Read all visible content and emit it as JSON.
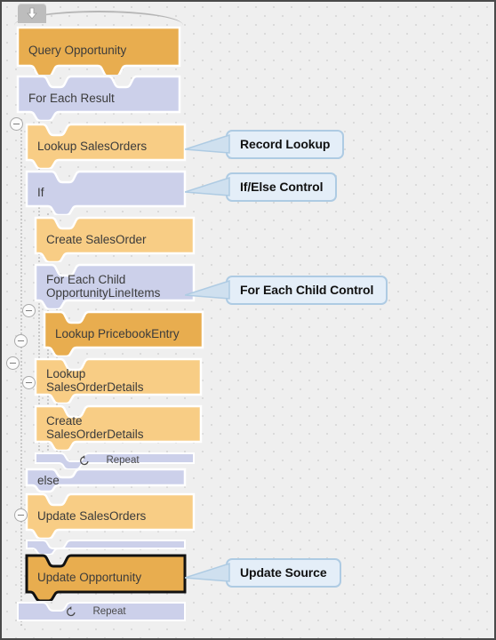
{
  "canvas": {
    "background_color": "#efefef",
    "grid": "dot-grid",
    "border_color": "#4a4a4a"
  },
  "toolbar": {
    "collapse_all_icon": "arrow-down-icon"
  },
  "palette": {
    "action_orange_dark": "#e8ad4f",
    "action_orange_light": "#f8cd85",
    "control_lavender": "#ccd0ea",
    "selected_border": "#111111",
    "callout_fill": "#e4eef8",
    "callout_border": "#aecbe3"
  },
  "blocks": [
    {
      "id": "query-opportunity",
      "label": "Query Opportunity",
      "type": "action",
      "color": "dark",
      "selected": false
    },
    {
      "id": "for-each-result",
      "label": "For Each Result",
      "type": "control",
      "color": "lavender",
      "selected": false
    },
    {
      "id": "lookup-salesorders",
      "label": "Lookup SalesOrders",
      "type": "action",
      "color": "light",
      "selected": false
    },
    {
      "id": "if",
      "label": "If",
      "type": "control",
      "color": "lavender",
      "selected": false
    },
    {
      "id": "create-salesorder",
      "label": "Create SalesOrder",
      "type": "action",
      "color": "light",
      "selected": false
    },
    {
      "id": "for-each-child",
      "label": "For Each Child\nOpportunityLineItems",
      "type": "control",
      "color": "lavender",
      "selected": false
    },
    {
      "id": "lookup-pricebookentry",
      "label": "Lookup PricebookEntry",
      "type": "action",
      "color": "dark",
      "selected": false
    },
    {
      "id": "lookup-salesorderdetails",
      "label": "Lookup\nSalesOrderDetails",
      "type": "action",
      "color": "light",
      "selected": false
    },
    {
      "id": "create-salesorderdetails",
      "label": "Create\nSalesOrderDetails",
      "type": "action",
      "color": "light",
      "selected": false
    },
    {
      "id": "repeat-inner",
      "label": "Repeat",
      "type": "repeat",
      "color": "lavender",
      "selected": false
    },
    {
      "id": "else",
      "label": "else",
      "type": "control",
      "color": "lavender",
      "selected": false
    },
    {
      "id": "update-salesorders",
      "label": "Update SalesOrders",
      "type": "action",
      "color": "light",
      "selected": false
    },
    {
      "id": "endif-bar",
      "label": "",
      "type": "thin",
      "color": "lavender",
      "selected": false
    },
    {
      "id": "update-opportunity",
      "label": "Update Opportunity",
      "type": "action",
      "color": "dark",
      "selected": true
    },
    {
      "id": "repeat-outer",
      "label": "Repeat",
      "type": "repeat",
      "color": "lavender",
      "selected": false
    }
  ],
  "callouts": [
    {
      "id": "callout-record-lookup",
      "label": "Record Lookup"
    },
    {
      "id": "callout-ifelse-control",
      "label": "If/Else Control"
    },
    {
      "id": "callout-foreachchild",
      "label": "For Each Child Control"
    },
    {
      "id": "callout-update-source",
      "label": "Update Source"
    }
  ],
  "collapse_buttons": [
    {
      "id": "collapse-1"
    },
    {
      "id": "collapse-2"
    },
    {
      "id": "collapse-3"
    },
    {
      "id": "collapse-4"
    },
    {
      "id": "collapse-5"
    },
    {
      "id": "collapse-6"
    }
  ]
}
